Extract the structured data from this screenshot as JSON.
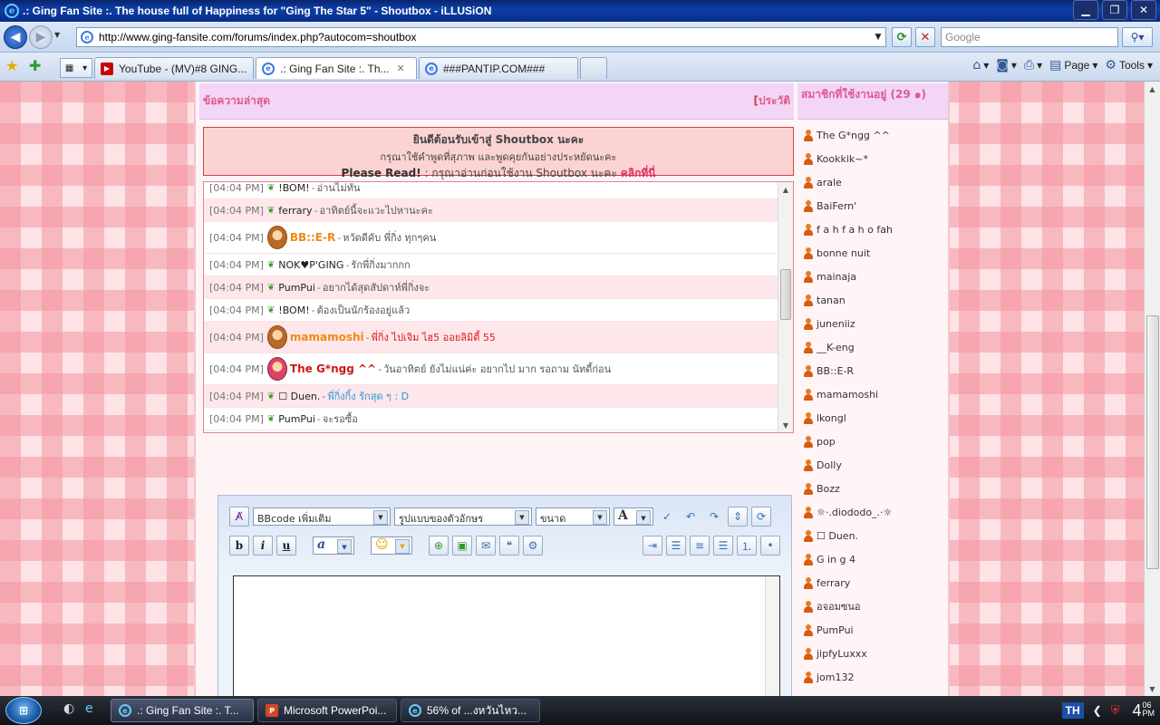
{
  "window": {
    "title": ".: Ging Fan Site :. The house full of Happiness for \"Ging The Star 5\" - Shoutbox - iLLUSiON",
    "minimize": "▁",
    "maximize": "❐",
    "close": "✕"
  },
  "address": {
    "url": "http://www.ging-fansite.com/forums/index.php?autocom=shoutbox",
    "search_placeholder": "Google"
  },
  "tabs": [
    {
      "label": "YouTube - (MV)#8 GING...",
      "icon": "youtube-icon"
    },
    {
      "label": ".: Ging Fan Site :. Th...",
      "icon": "ie-page-icon",
      "active": true
    },
    {
      "label": "###PANTIP.COM###",
      "icon": "ie-page-icon"
    }
  ],
  "commandbar": {
    "page_label": "Page",
    "tools_label": "Tools"
  },
  "shoutbox": {
    "header": "ข้อความล่าสุด",
    "history_link": "ประวัติ",
    "welcome_title": "ยินดีต้อนรับเข้าสู่ Shoutbox นะคะ",
    "welcome_line2": "กรุณาใช้คำพูดที่สุภาพ และพูดคุยกันอย่างประหยัดนะคะ",
    "welcome_please": "Please Read!",
    "welcome_line3": " : กรุณาอ่านก่อนใช้งาน Shoutbox นะคะ ",
    "welcome_link": "คลิกที่นี่",
    "messages": [
      {
        "time": "[04:04 PM]",
        "user": "!BOM!",
        "text": "อ่านไม่ทัน",
        "style": "plain"
      },
      {
        "time": "[04:04 PM]",
        "user": "ferrary",
        "text": "อาทิตย์นี้จะแวะไปหานะคะ",
        "style": "plain"
      },
      {
        "time": "[04:04 PM]",
        "user": "BB::E-R",
        "text": "หวัดดีคับ พี่กิ่ง ทุกๆคน",
        "style": "orange"
      },
      {
        "time": "[04:04 PM]",
        "user": "NOK♥P'GING",
        "text": "รักพี่กิ่งมากกก",
        "style": "plain"
      },
      {
        "time": "[04:04 PM]",
        "user": "PumPui",
        "text": "อยากได้สุดสัปดาห์พี่กิ่งจะ",
        "style": "plain"
      },
      {
        "time": "[04:04 PM]",
        "user": "!BOM!",
        "text": "ต้องเป็นนักร้องอยู่แล้ว",
        "style": "plain"
      },
      {
        "time": "[04:04 PM]",
        "user": "mamamoshi",
        "text": "พี่กิ่ง ไปเจิม ไฮ5 ออยลิมิตี้ 55",
        "style": "orange-red"
      },
      {
        "time": "[04:04 PM]",
        "user": "The G*ngg ^^",
        "text": "วันอาทิตย์ ยังไม่แน่ค่ะ อยากไป มาก รอถาม นัทดี้ก่อน",
        "style": "red"
      },
      {
        "time": "[04:04 PM]",
        "user": "☐ Duen.",
        "text": "พี่กิ่งกิ้ง รักสุด ๆ : D",
        "style": "blue"
      },
      {
        "time": "[04:04 PM]",
        "user": "PumPui",
        "text": "จะรอซื้อ",
        "style": "plain"
      }
    ]
  },
  "editor": {
    "bbcode_select": "BBcode เพิ่มเติม",
    "font_select": "รูปแบบของตัวอักษร",
    "size_select": "ขนาด",
    "color_label": "A",
    "bold": "b",
    "italic": "i",
    "underline": "u",
    "highlight": "a"
  },
  "online": {
    "header": "สมาชิกที่ใช้งานอยู่ (29 ๑)",
    "users": [
      "The G*ngg ^^",
      "Kookkik~*",
      "arale",
      "BaiFern'",
      "f a h f a h o fah",
      "bonne nuit",
      "mainaja",
      "tanan",
      "juneniiz",
      "__K-eng",
      "BB::E-R",
      "mamamoshi",
      "lkongl",
      "pop",
      "Dolly",
      "Bozz",
      "☼·.diododo_.·☼",
      "☐ Duen.",
      "G in g 4",
      "ferrary",
      "อจอมซนอ",
      "PumPui",
      "jipfyLuxxx",
      "jom132"
    ]
  },
  "taskbar": {
    "start": "⊞",
    "items": [
      {
        "label": ".: Ging Fan Site :. T...",
        "icon": "ie"
      },
      {
        "label": "Microsoft PowerPoi...",
        "icon": "ppt"
      },
      {
        "label": "56% of ...งหวันไหว...",
        "icon": "ie"
      }
    ],
    "lang": "TH",
    "clock_hour": "4",
    "clock_min": "06",
    "clock_ampm": "PM"
  }
}
